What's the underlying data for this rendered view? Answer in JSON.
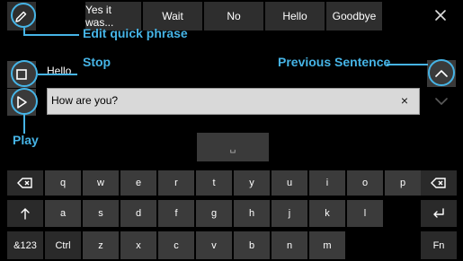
{
  "top_bar": {
    "phrases": [
      "Yes it was...",
      "Wait",
      "No",
      "Hello",
      "Goodbye"
    ]
  },
  "spoken_text": "Hello",
  "input": {
    "value": "How are you?"
  },
  "space_label": "␣",
  "keyboard": {
    "row1": [
      "q",
      "w",
      "e",
      "r",
      "t",
      "y",
      "u",
      "i",
      "o",
      "p"
    ],
    "row2": [
      "a",
      "s",
      "d",
      "f",
      "g",
      "h",
      "j",
      "k",
      "l"
    ],
    "row3": [
      "z",
      "x",
      "c",
      "v",
      "b",
      "n",
      "m"
    ],
    "bottom": {
      "left": "&123",
      "ctrl": "Ctrl",
      "fn": "Fn"
    }
  },
  "callouts": {
    "edit": "Edit quick phrase",
    "stop": "Stop",
    "play": "Play",
    "prev": "Previous Sentence"
  },
  "colors": {
    "accent": "#46b4e6"
  }
}
